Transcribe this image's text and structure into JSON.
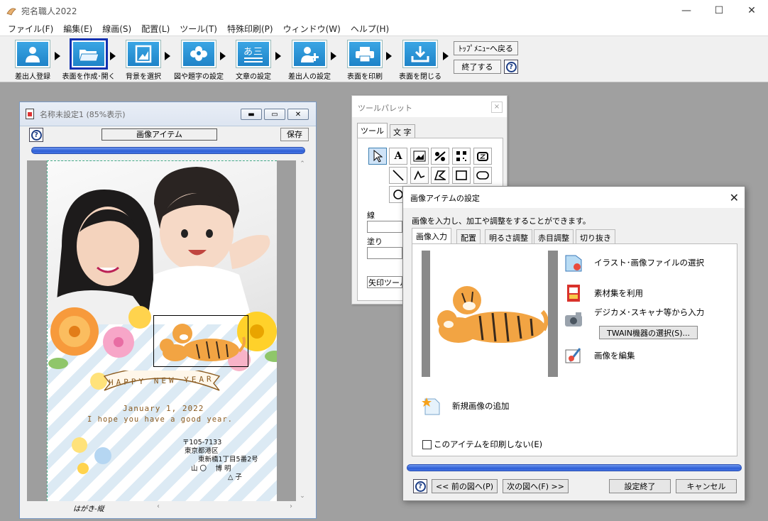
{
  "app": {
    "title": "宛名職人2022"
  },
  "menu": [
    "ファイル(F)",
    "編集(E)",
    "線画(S)",
    "配置(L)",
    "ツール(T)",
    "特殊印刷(P)",
    "ウィンドウ(W)",
    "ヘルプ(H)"
  ],
  "toolbar": {
    "buttons": [
      "差出人登録",
      "表面を作成･開く",
      "背景を選択",
      "図や題字の設定",
      "文章の設定",
      "差出人の設定",
      "表面を印刷",
      "表面を閉じる"
    ],
    "top_menu_label": "ﾄｯﾌﾟﾒﾆｭｰへ戻る",
    "exit_label": "終了する",
    "help": "?"
  },
  "document": {
    "title": "名称未設定1 (85%表示)",
    "item_field": "画像アイテム",
    "save": "保存",
    "help": "?",
    "status": "はがき-縦",
    "card": {
      "greeting": "HAPPY NEW YEAR",
      "date": "January 1, 2022",
      "message": "I hope you have a good year.",
      "postal": "〒105-7133",
      "address1": "東京都港区",
      "address2": "東新橋1丁目5番2号",
      "name1": "山 〇　 博 明",
      "name2": "△ 子"
    }
  },
  "palette": {
    "title": "ツールパレット",
    "close": "×",
    "tabs": [
      "ツール",
      "文 字"
    ],
    "line_label": "線",
    "fill_label": "塗り",
    "tool_name": "矢印ツール"
  },
  "dialog": {
    "title": "画像アイテムの設定",
    "close": "✕",
    "description": "画像を入力し、加工や調整をすることができます。",
    "tabs": [
      "画像入力",
      "配置",
      "明るさ調整",
      "赤目調整",
      "切り抜き"
    ],
    "actions": {
      "select_file": "イラスト･画像ファイルの選択",
      "use_library": "素材集を利用",
      "camera_input": "デジカメ･スキャナ等から入力",
      "twain": "TWAIN機器の選択(S)...",
      "edit": "画像を編集",
      "new_image": "新規画像の追加"
    },
    "no_print": "このアイテムを印刷しない(E)",
    "help": "?",
    "prev": "<< 前の図へ(P)",
    "next": "次の図へ(F) >>",
    "finish": "設定終了",
    "cancel": "キャンセル"
  },
  "colors": {
    "accent": "#2f5fd6",
    "toolbar_icon": "#2590d4",
    "selected_border": "#1030b0"
  }
}
